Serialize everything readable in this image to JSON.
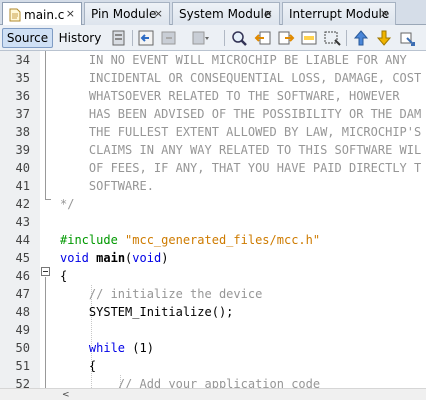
{
  "tabs": [
    {
      "label": "main.c",
      "active": true
    },
    {
      "label": "Pin Module",
      "active": false
    },
    {
      "label": "System Module",
      "active": false
    },
    {
      "label": "Interrupt Module",
      "active": false
    }
  ],
  "tab_close_glyph": "×",
  "toolbar": {
    "source_label": "Source",
    "history_label": "History",
    "icons": [
      "last-edit-icon",
      "back-icon",
      "forward-icon",
      "find-icon",
      "find-previous-icon",
      "find-next-icon",
      "toggle-highlight-icon",
      "toggle-rect-select-icon",
      "previous-bookmark-icon",
      "next-bookmark-icon",
      "toggle-bookmark-icon"
    ]
  },
  "editor": {
    "line_numbers": [
      "34",
      "35",
      "36",
      "37",
      "38",
      "39",
      "40",
      "41",
      "42",
      "43",
      "44",
      "45",
      "46",
      "47",
      "48",
      "49",
      "50",
      "51",
      "52"
    ],
    "lines": {
      "l34": "    IN NO EVENT WILL MICROCHIP BE LIABLE FOR ANY",
      "l35": "    INCIDENTAL OR CONSEQUENTIAL LOSS, DAMAGE, COST",
      "l36": "    WHATSOEVER RELATED TO THE SOFTWARE, HOWEVER",
      "l37": "    HAS BEEN ADVISED OF THE POSSIBILITY OR THE DAM",
      "l38": "    THE FULLEST EXTENT ALLOWED BY LAW, MICROCHIP'S",
      "l39": "    CLAIMS IN ANY WAY RELATED TO THIS SOFTWARE WIL",
      "l40": "    OF FEES, IF ANY, THAT YOU HAVE PAID DIRECTLY T",
      "l41": "    SOFTWARE.",
      "l42": "*/",
      "l44_directive": "#include",
      "l44_path": "\"mcc_generated_files/mcc.h\"",
      "l45_void": "void",
      "l45_main": "main",
      "l45_open": "(",
      "l45_param": "void",
      "l45_close": ")",
      "l46": "{",
      "l47": "    // initialize the device",
      "l48": "    SYSTEM_Initialize();",
      "l50_kw": "while",
      "l50_rest": " (1)",
      "l51": "    {",
      "l52": "        // Add your application code"
    }
  },
  "scrollbar_arrow": "<"
}
